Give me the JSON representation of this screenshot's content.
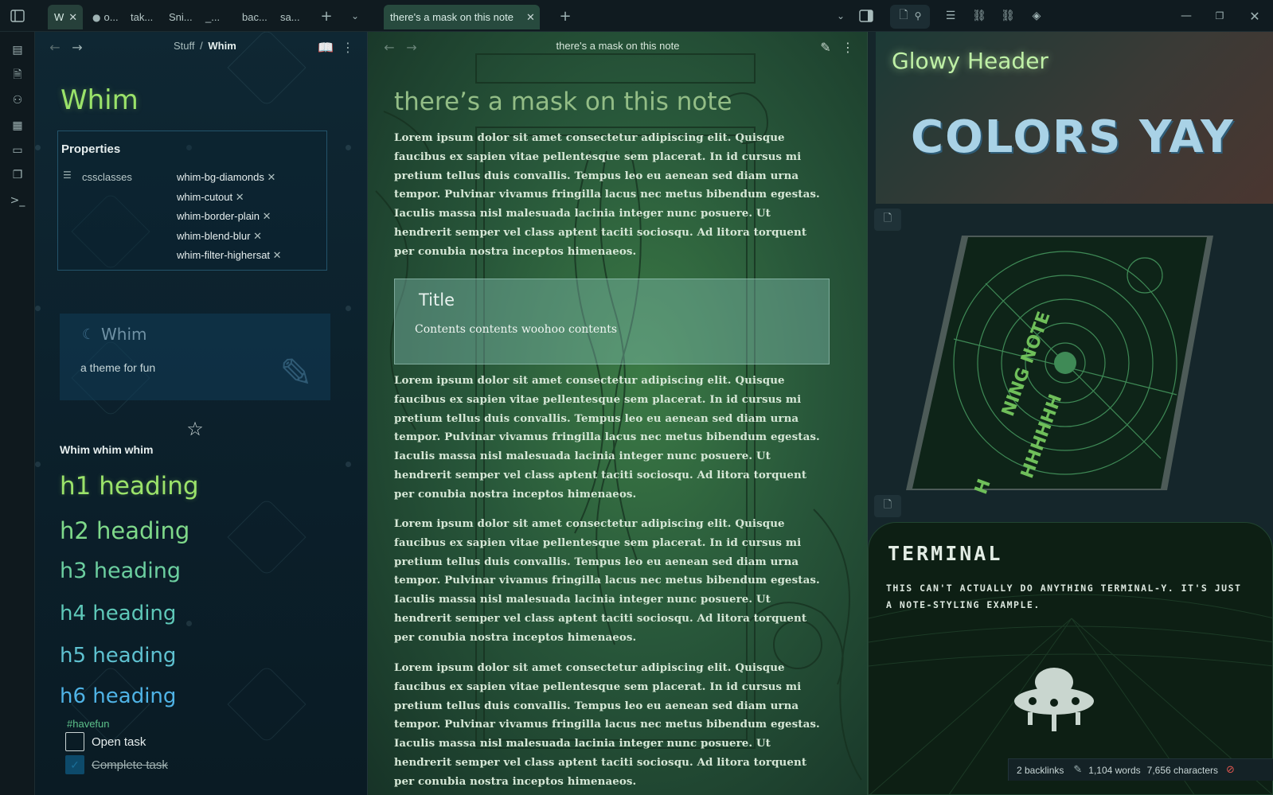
{
  "tabs_left": [
    {
      "label": "W",
      "active": true
    },
    {
      "label": "o..."
    },
    {
      "label": "tak..."
    },
    {
      "label": "Sni..."
    },
    {
      "label": "_..."
    },
    {
      "label": "bac..."
    },
    {
      "label": "sa..."
    }
  ],
  "tab_main": {
    "label": "there's a mask on this note"
  },
  "left_pane": {
    "breadcrumb_parent": "Stuff",
    "breadcrumb_sep": "/",
    "breadcrumb_current": "Whim",
    "title": "Whim",
    "properties": {
      "heading": "Properties",
      "key": "cssclasses",
      "values": [
        "whim-bg-diamonds",
        "whim-cutout",
        "whim-border-plain",
        "whim-blend-blur",
        "whim-filter-highersat"
      ]
    },
    "callout": {
      "title": "Whim",
      "body": "a theme for fun"
    },
    "bold_text": "Whim whim whim",
    "headings": [
      "h1 heading",
      "h2 heading",
      "h3 heading",
      "h4 heading",
      "h5 heading",
      "h6 heading"
    ],
    "tag": "#havefun",
    "tasks": [
      {
        "label": "Open task",
        "done": false
      },
      {
        "label": "Complete task",
        "done": true
      }
    ]
  },
  "middle_pane": {
    "header_title": "there's a mask on this note",
    "note_title": "there’s a mask on this note",
    "lorem": "Lorem ipsum dolor sit amet consectetur adipiscing elit. Quisque faucibus ex sapien vitae pellentesque sem placerat. In id cursus mi pretium tellus duis convallis. Tempus leo eu aenean sed diam urna tempor. Pulvinar vivamus fringilla lacus nec metus bibendum egestas. Iaculis massa nisl malesuada lacinia integer nunc posuere. Ut hendrerit semper vel class aptent taciti sociosqu. Ad litora torquent per conubia nostra inceptos himenaeos.",
    "callout": {
      "title": "Title",
      "body": "Contents contents woohoo contents"
    }
  },
  "right_pane": {
    "glowy_header": "Glowy Header",
    "colors_yay": "COLORS YAY",
    "image_text_1": "NING NOTE",
    "image_text_2": "HHHHHH",
    "image_text_3": "H",
    "terminal_title": "TERMINAL",
    "terminal_body": "THIS CAN'T ACTUALLY DO ANYTHING TERMINAL-Y. IT'S JUST A NOTE-STYLING EXAMPLE."
  },
  "status_bar": {
    "backlinks": "2 backlinks",
    "words": "1,104 words",
    "characters": "7,656 characters"
  },
  "colors": {
    "accent_green": "#9be36a",
    "heading_h2": "#7fd98a",
    "heading_h5": "#5ec1d0",
    "heading_h6": "#4fb3e6"
  }
}
